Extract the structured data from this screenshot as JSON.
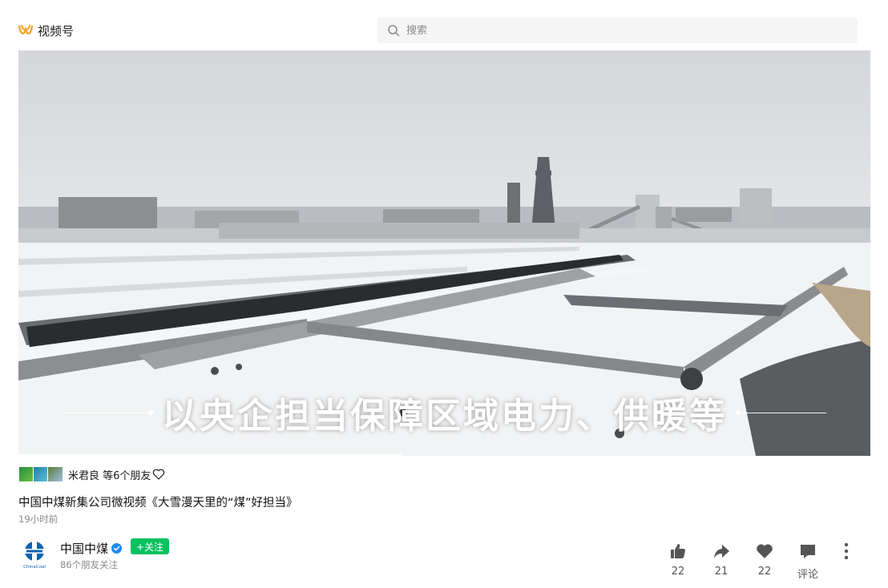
{
  "header": {
    "brand": "视频号",
    "search_placeholder": "搜索"
  },
  "video": {
    "subtitle": "以央企担当保障区域电力、供暖等",
    "progress_fraction": 0.45
  },
  "friends": {
    "text": "米君良 等6个朋友"
  },
  "post": {
    "title": "中国中煤新集公司微视频《大雪漫天里的“煤”好担当》",
    "time": "19小时前"
  },
  "author": {
    "name": "中国中煤",
    "follow_label": "+关注",
    "followers": "86个朋友关注",
    "logo_text": "ChinaCoal"
  },
  "actions": {
    "like": "22",
    "share": "21",
    "favorite": "22",
    "comment": "评论"
  },
  "colors": {
    "accent": "#07c160",
    "brand": "#f5a623",
    "verified": "#1d8cf0",
    "logo": "#0b63b0"
  }
}
